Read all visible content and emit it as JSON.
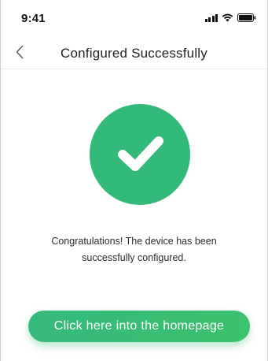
{
  "status_bar": {
    "time": "9:41",
    "icons": [
      "signal-icon",
      "wifi-icon",
      "battery-icon"
    ]
  },
  "nav_bar": {
    "back_icon": "chevron-left-icon",
    "title": "Configured Successfully"
  },
  "success": {
    "icon": "checkmark-icon",
    "color": "#33b978",
    "message": "Congratulations! The device has been successfully configured."
  },
  "actions": {
    "homepage_button_label": "Click here into the homepage",
    "color": "#38bd76"
  }
}
